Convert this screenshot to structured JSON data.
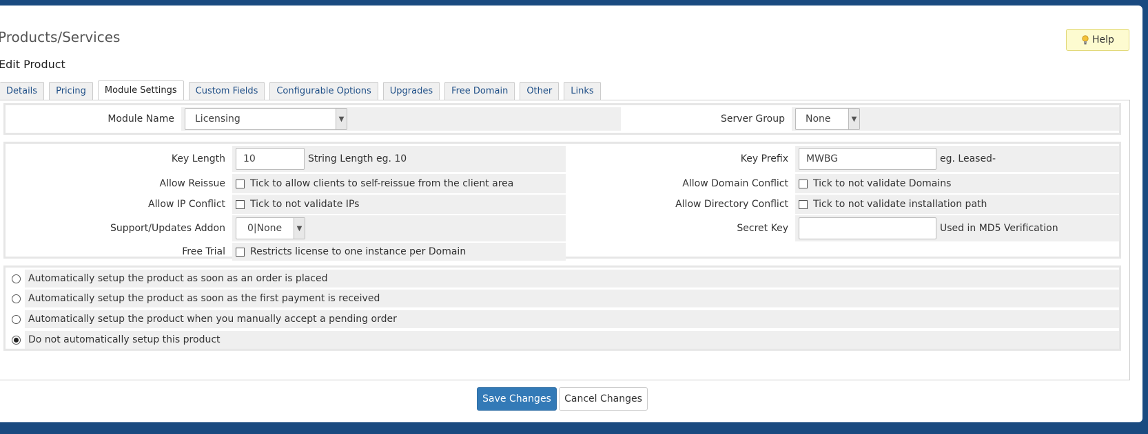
{
  "header": {
    "title": "Products/Services",
    "subtitle": "Edit Product",
    "help_label": "Help"
  },
  "tabs": [
    {
      "label": "Details"
    },
    {
      "label": "Pricing"
    },
    {
      "label": "Module Settings",
      "active": true
    },
    {
      "label": "Custom Fields"
    },
    {
      "label": "Configurable Options"
    },
    {
      "label": "Upgrades"
    },
    {
      "label": "Free Domain"
    },
    {
      "label": "Other"
    },
    {
      "label": "Links"
    }
  ],
  "module": {
    "module_name_label": "Module Name",
    "module_name_value": "Licensing",
    "server_group_label": "Server Group",
    "server_group_value": "None"
  },
  "settings": {
    "key_length": {
      "label": "Key Length",
      "value": "10",
      "hint": "String Length eg. 10"
    },
    "key_prefix": {
      "label": "Key Prefix",
      "value": "MWBG",
      "hint": "eg. Leased-"
    },
    "allow_reissue": {
      "label": "Allow Reissue",
      "text": "Tick to allow clients to self-reissue from the client area",
      "checked": false
    },
    "allow_domain_conflict": {
      "label": "Allow Domain Conflict",
      "text": "Tick to not validate Domains",
      "checked": false
    },
    "allow_ip_conflict": {
      "label": "Allow IP Conflict",
      "text": "Tick to not validate IPs",
      "checked": false
    },
    "allow_directory_conflict": {
      "label": "Allow Directory Conflict",
      "text": "Tick to not validate installation path",
      "checked": false
    },
    "support_addon": {
      "label": "Support/Updates Addon",
      "value": "0|None"
    },
    "secret_key": {
      "label": "Secret Key",
      "value": "",
      "hint": "Used in MD5 Verification"
    },
    "free_trial": {
      "label": "Free Trial",
      "text": "Restricts license to one instance per Domain",
      "checked": false
    }
  },
  "setup_options": [
    {
      "label": "Automatically setup the product as soon as an order is placed",
      "selected": false
    },
    {
      "label": "Automatically setup the product as soon as the first payment is received",
      "selected": false
    },
    {
      "label": "Automatically setup the product when you manually accept a pending order",
      "selected": false
    },
    {
      "label": "Do not automatically setup this product",
      "selected": true
    }
  ],
  "actions": {
    "save_label": "Save Changes",
    "cancel_label": "Cancel Changes"
  },
  "colors": {
    "frame": "#1a4a80",
    "primary_button": "#337ab7",
    "tab_text": "#1f4f87",
    "help_bg": "#fdfbd0"
  }
}
